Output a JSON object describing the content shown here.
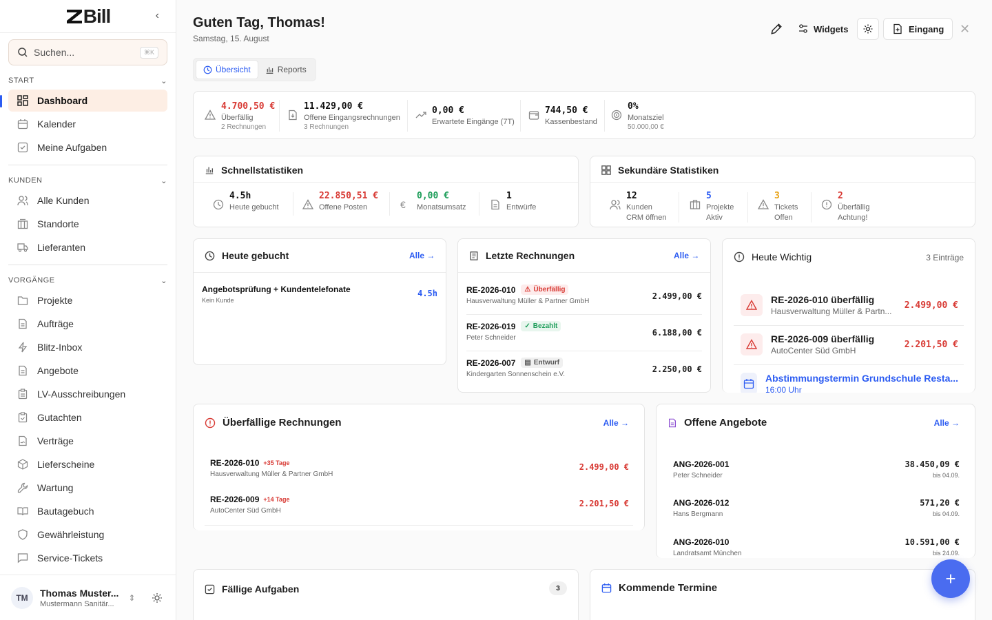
{
  "app": {
    "logo": "Bill",
    "search_placeholder": "Suchen...",
    "search_kbd": "⌘K"
  },
  "sidebar": {
    "sections": {
      "start": "START",
      "kunden": "KUNDEN",
      "vorgaenge": "VORGÄNGE"
    },
    "start": [
      "Dashboard",
      "Kalender",
      "Meine Aufgaben"
    ],
    "kunden": [
      "Alle Kunden",
      "Standorte",
      "Lieferanten"
    ],
    "vorgaenge": [
      "Projekte",
      "Aufträge",
      "Blitz-Inbox",
      "Angebote",
      "LV-Ausschreibungen",
      "Gutachten",
      "Verträge",
      "Lieferscheine",
      "Wartung",
      "Bautagebuch",
      "Gewährleistung",
      "Service-Tickets"
    ],
    "user": {
      "initials": "TM",
      "name": "Thomas Muster...",
      "company": "Mustermann Sanitär..."
    }
  },
  "header": {
    "greeting": "Guten Tag, Thomas!",
    "date": "Samstag, 15. August",
    "widgets": "Widgets",
    "eingang": "Eingang"
  },
  "tabs": [
    "Übersicht",
    "Reports"
  ],
  "kpis": [
    {
      "value": "4.700,50 €",
      "label": "Überfällig",
      "sub": "2 Rechnungen"
    },
    {
      "value": "11.429,00 €",
      "label": "Offene Eingangsrechnungen",
      "sub": "3 Rechnungen"
    },
    {
      "value": "0,00 €",
      "label": "Erwartete Eingänge (7T)",
      "sub": ""
    },
    {
      "value": "744,50 €",
      "label": "Kassenbestand",
      "sub": ""
    },
    {
      "value": "0%",
      "label": "Monatsziel",
      "sub": "50.000,00 €"
    }
  ],
  "schnell": {
    "title": "Schnellstatistiken",
    "items": [
      {
        "value": "4.5h",
        "label": "Heute gebucht"
      },
      {
        "value": "22.850,51 €",
        "label": "Offene Posten"
      },
      {
        "value": "0,00 €",
        "label": "Monatsumsatz"
      },
      {
        "value": "1",
        "label": "Entwürfe"
      }
    ]
  },
  "sekundaer": {
    "title": "Sekundäre Statistiken",
    "items": [
      {
        "value": "12",
        "label": "Kunden",
        "sub": "CRM öffnen"
      },
      {
        "value": "5",
        "label": "Projekte",
        "sub": "Aktiv"
      },
      {
        "value": "3",
        "label": "Tickets",
        "sub": "Offen"
      },
      {
        "value": "2",
        "label": "Überfällig",
        "sub": "Achtung!"
      }
    ]
  },
  "heute_gebucht": {
    "title": "Heute gebucht",
    "alle": "Alle →",
    "entry": {
      "title": "Angebotsprüfung + Kundentelefonate",
      "sub": "Kein Kunde",
      "hours": "4.5h"
    }
  },
  "letzte_rechnungen": {
    "title": "Letzte Rechnungen",
    "alle": "Alle →",
    "rows": [
      {
        "id": "RE-2026-010",
        "status": "Überfällig",
        "customer": "Hausverwaltung Müller & Partner GmbH",
        "amount": "2.499,00 €"
      },
      {
        "id": "RE-2026-019",
        "status": "Bezahlt",
        "customer": "Peter Schneider",
        "amount": "6.188,00 €"
      },
      {
        "id": "RE-2026-007",
        "status": "Entwurf",
        "customer": "Kindergarten Sonnenschein e.V.",
        "amount": "2.250,00 €"
      }
    ]
  },
  "heute_wichtig": {
    "title": "Heute Wichtig",
    "count": "3 Einträge",
    "rows": [
      {
        "title": "RE-2026-010 überfällig",
        "sub": "Hausverwaltung Müller & Partn...",
        "amount": "2.499,00 €"
      },
      {
        "title": "RE-2026-009 überfällig",
        "sub": "AutoCenter Süd GmbH",
        "amount": "2.201,50 €"
      },
      {
        "title": "Abstimmungstermin Grundschule Resta...",
        "sub": "16:00 Uhr",
        "amount": ""
      }
    ]
  },
  "ueberfaellig": {
    "title": "Überfällige Rechnungen",
    "alle": "Alle →",
    "rows": [
      {
        "id": "RE-2026-010",
        "days": "+35 Tage",
        "customer": "Hausverwaltung Müller & Partner GmbH",
        "amount": "2.499,00 €"
      },
      {
        "id": "RE-2026-009",
        "days": "+14 Tage",
        "customer": "AutoCenter Süd GmbH",
        "amount": "2.201,50 €"
      }
    ]
  },
  "angebote": {
    "title": "Offene Angebote",
    "alle": "Alle →",
    "rows": [
      {
        "id": "ANG-2026-001",
        "customer": "Peter Schneider",
        "amount": "38.450,09 €",
        "due": "bis 04.09."
      },
      {
        "id": "ANG-2026-012",
        "customer": "Hans Bergmann",
        "amount": "571,20 €",
        "due": "bis 04.09."
      },
      {
        "id": "ANG-2026-010",
        "customer": "Landratsamt München",
        "amount": "10.591,00 €",
        "due": "bis 24.09."
      }
    ]
  },
  "aufgaben": {
    "title": "Fällige Aufgaben",
    "count": "3"
  },
  "termine": {
    "title": "Kommende Termine"
  },
  "fab": "+"
}
